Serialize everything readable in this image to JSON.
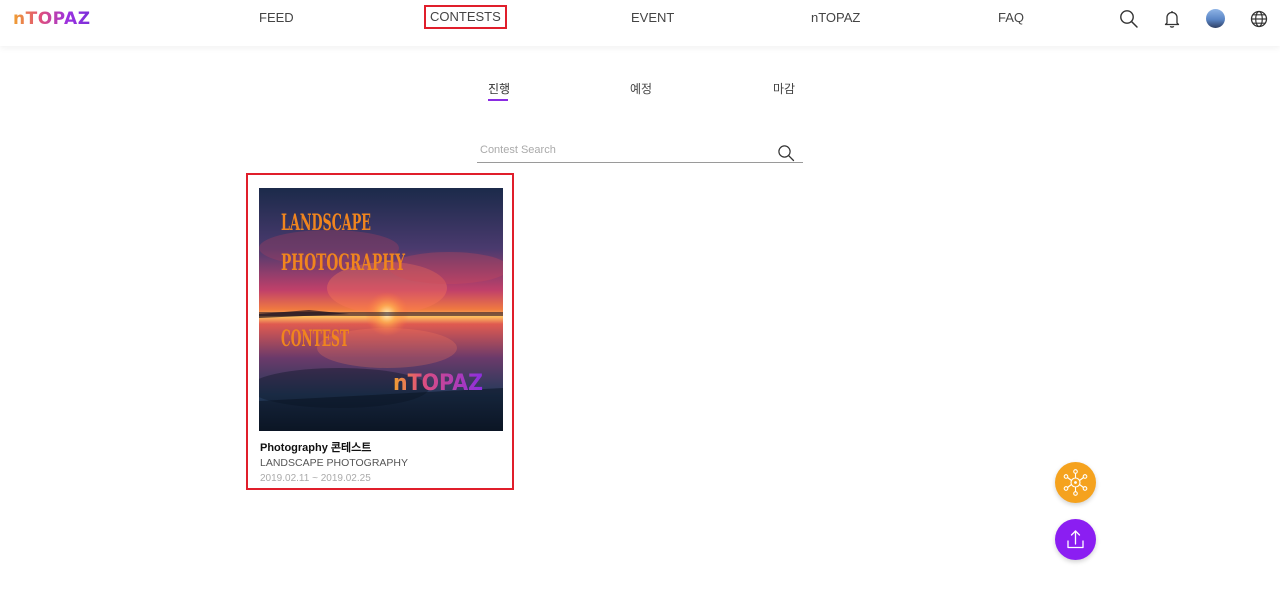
{
  "brand": {
    "logo_text": "nTOPAZ"
  },
  "nav": {
    "items": [
      {
        "label": "FEED"
      },
      {
        "label": "CONTESTS"
      },
      {
        "label": "EVENT"
      },
      {
        "label": "nTOPAZ"
      },
      {
        "label": "FAQ"
      }
    ],
    "icons": [
      "search-icon",
      "bell-icon",
      "avatar",
      "globe-icon"
    ]
  },
  "tabs": [
    {
      "label": "진행",
      "active": true
    },
    {
      "label": "예정",
      "active": false
    },
    {
      "label": "마감",
      "active": false
    }
  ],
  "search": {
    "placeholder": "Contest Search",
    "value": ""
  },
  "contests": [
    {
      "image": {
        "line1": "LANDSCAPE",
        "line2": "PHOTOGRAPHY",
        "line3": "CONTEST",
        "watermark": "nTOPAZ"
      },
      "title": "Photography 콘테스트",
      "subtitle": "LANDSCAPE PHOTOGRAPHY",
      "dates": "2019.02.11 ~ 2019.02.25"
    }
  ],
  "fabs": {
    "orange": "network-icon",
    "purple": "upload-icon"
  },
  "colors": {
    "accent": "#8a2be2",
    "highlight": "#e01e2b",
    "fab_orange": "#f5a21e",
    "fab_purple": "#8b1ef2",
    "image_text": "#f0851e"
  }
}
